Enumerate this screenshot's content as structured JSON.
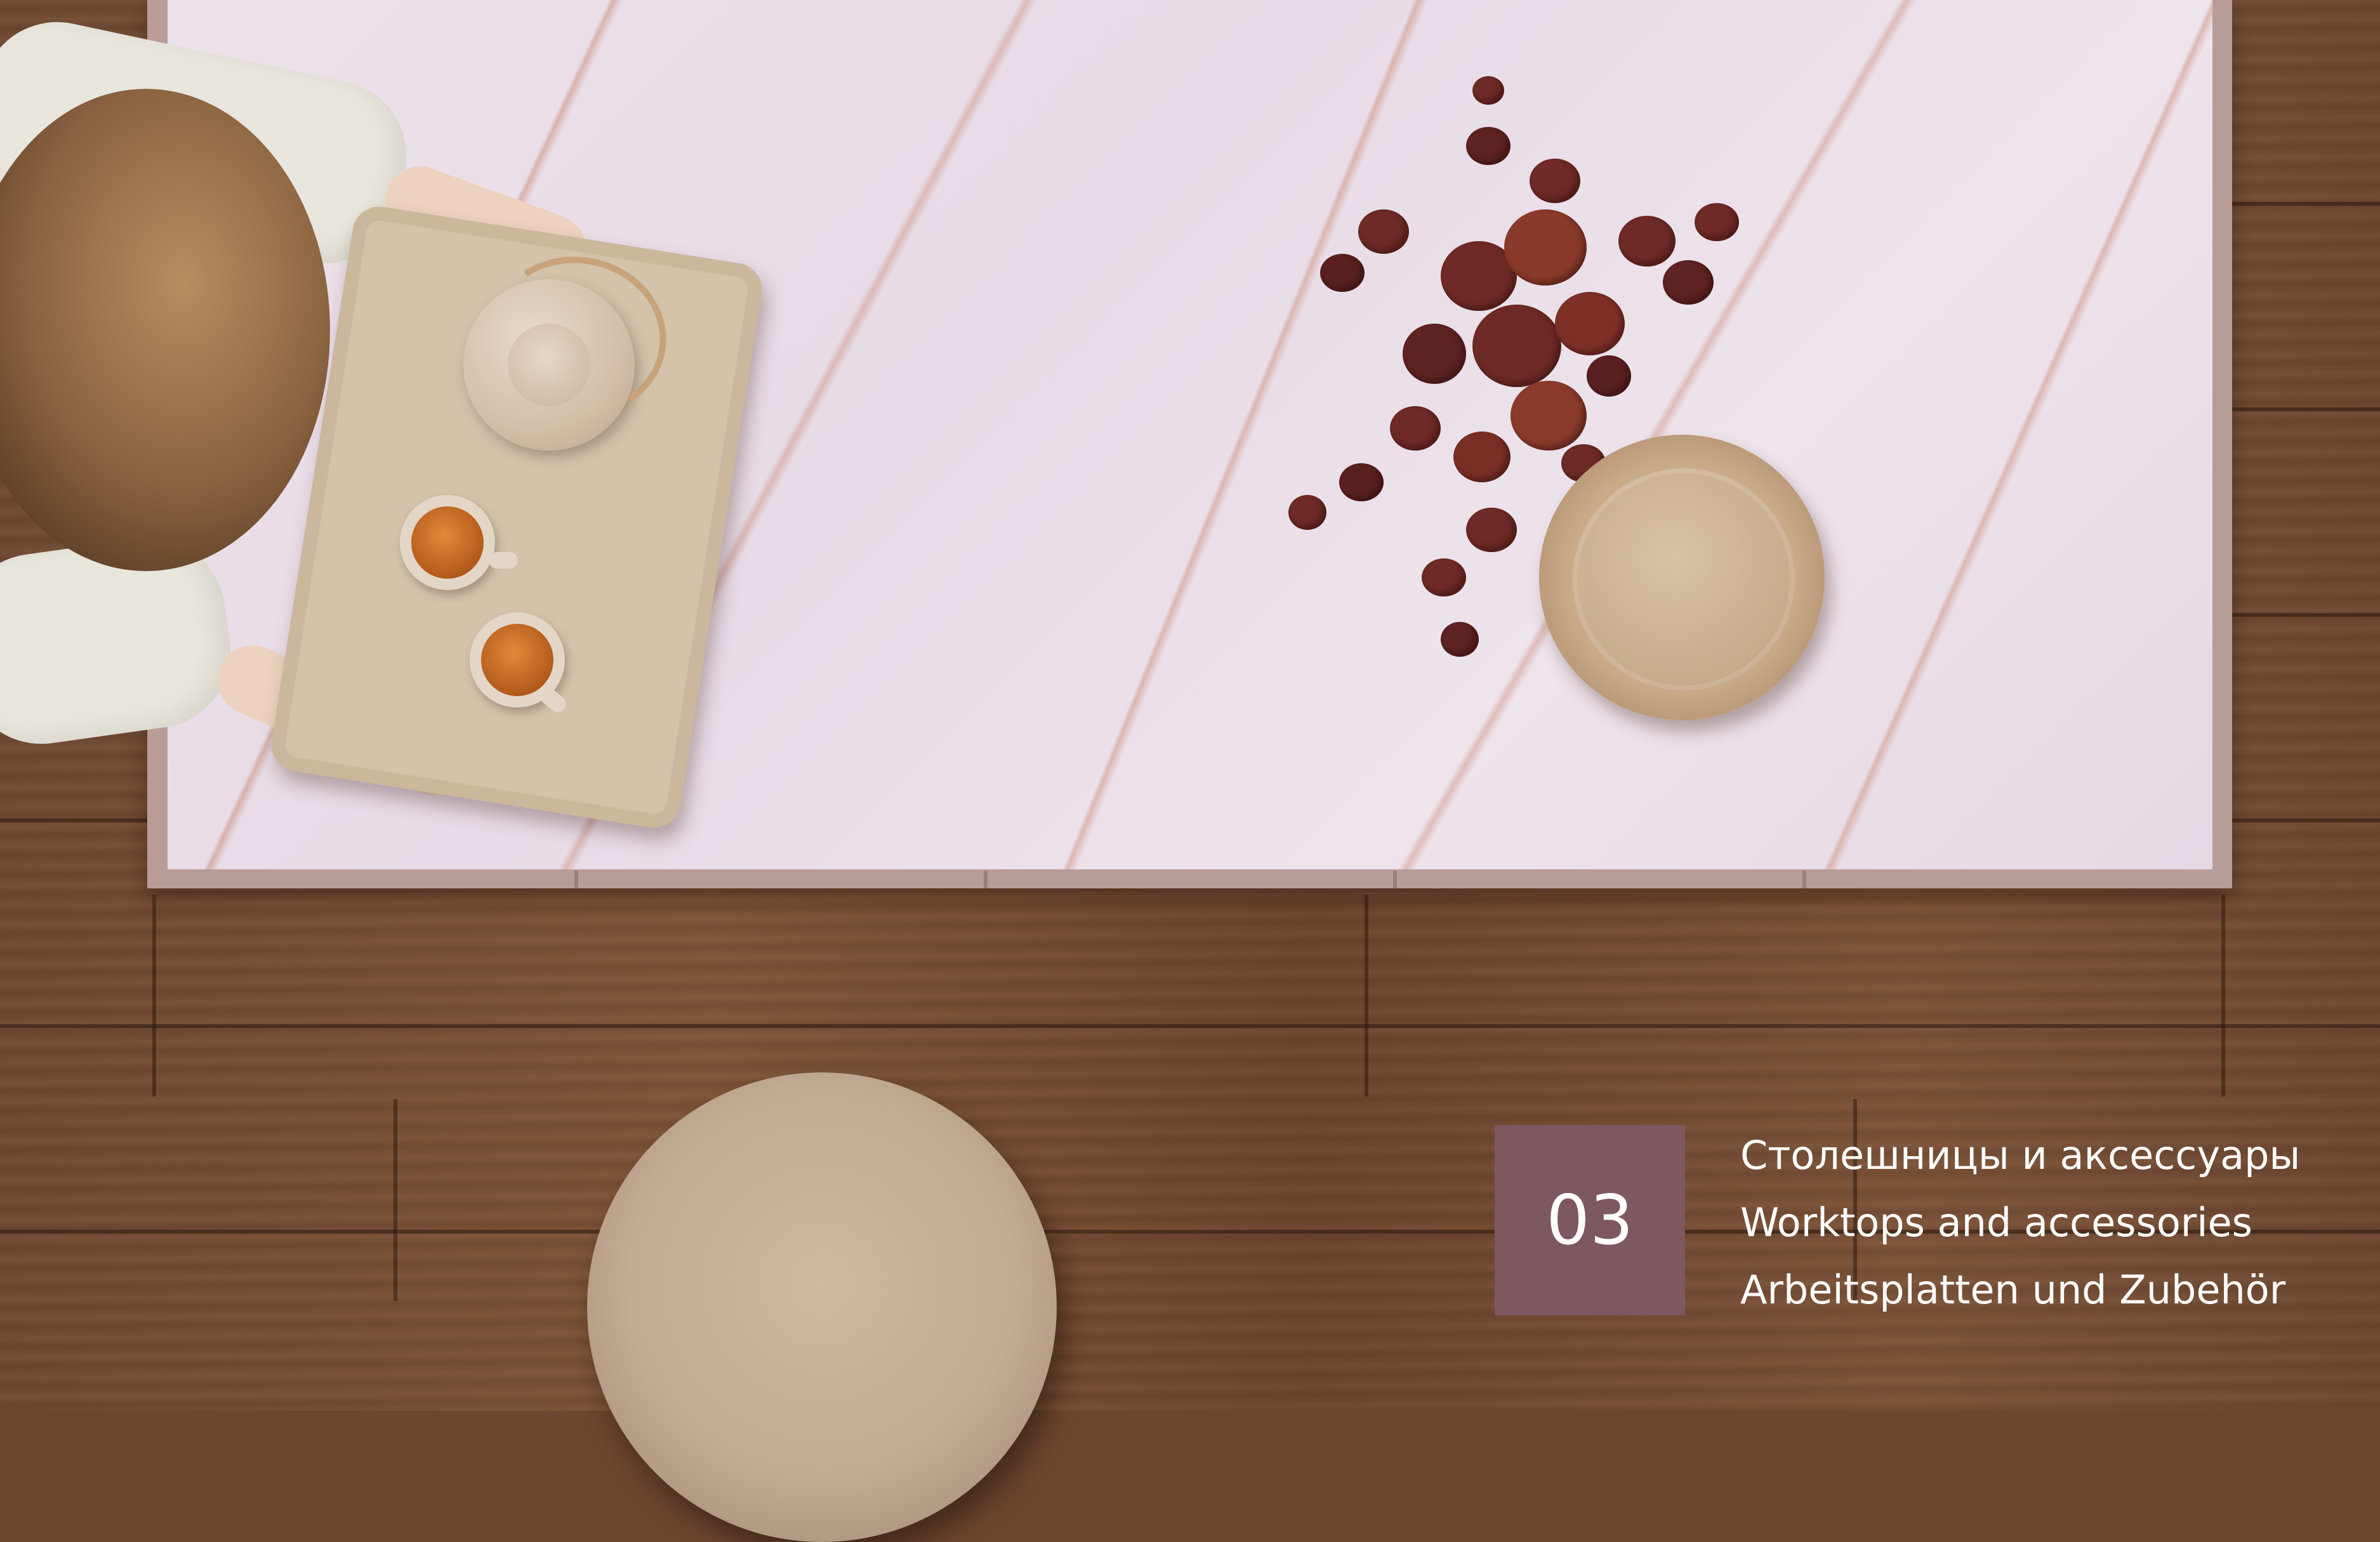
{
  "chapter": {
    "number": "03",
    "titles": [
      "Столешницы и аксессуары",
      "Worktops and accessories",
      "Arbeitsplatten und Zubehör"
    ]
  },
  "colors": {
    "chapter_box": "#7d5860",
    "caption_text": "#ffffff"
  }
}
